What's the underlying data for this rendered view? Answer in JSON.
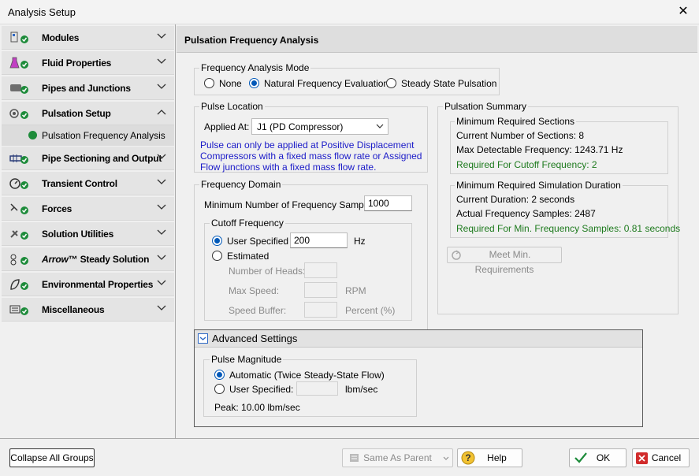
{
  "window": {
    "title": "Analysis Setup",
    "close_glyph": "✕"
  },
  "sidebar": {
    "items": [
      {
        "label": "Modules",
        "icon": "modules-icon"
      },
      {
        "label": "Fluid Properties",
        "icon": "flask-icon"
      },
      {
        "label": "Pipes and Junctions",
        "icon": "pipe-icon"
      },
      {
        "label": "Pulsation Setup",
        "icon": "pulsation-icon",
        "expanded": true
      },
      {
        "label": "Pipe Sectioning and Output",
        "icon": "sectioning-icon"
      },
      {
        "label": "Transient Control",
        "icon": "transient-icon"
      },
      {
        "label": "Forces",
        "icon": "forces-icon"
      },
      {
        "label": "Solution Utilities",
        "icon": "utilities-icon"
      },
      {
        "label": "™ Steady Solution",
        "brand": "Arrow",
        "icon": "steady-icon"
      },
      {
        "label": "Environmental Properties",
        "icon": "environment-icon"
      },
      {
        "label": "Miscellaneous",
        "icon": "misc-icon"
      }
    ],
    "subitem": {
      "label": "Pulsation Frequency Analysis"
    }
  },
  "main": {
    "title": "Pulsation Frequency Analysis",
    "mode": {
      "legend": "Frequency Analysis Mode",
      "options": [
        "None",
        "Natural Frequency Evaluation",
        "Steady State Pulsation"
      ],
      "selected": "Natural Frequency Evaluation"
    },
    "pulse_location": {
      "legend": "Pulse Location",
      "applied_label": "Applied At:",
      "applied_value": "J1 (PD Compressor)",
      "note_lines": [
        "Pulse can only be applied at Positive Displacement",
        "Compressors with a fixed mass flow rate or Assigned",
        "Flow junctions with a fixed mass flow rate."
      ]
    },
    "frequency_domain": {
      "legend": "Frequency Domain",
      "min_samples_label": "Minimum Number of Frequency Samples:",
      "min_samples_value": "1000",
      "cutoff": {
        "legend": "Cutoff Frequency",
        "user_label": "User Specified",
        "user_value": "200",
        "user_unit": "Hz",
        "estimated_label": "Estimated",
        "heads_label": "Number of Heads:",
        "speed_label": "Max Speed:",
        "speed_unit": "RPM",
        "buffer_label": "Speed Buffer:",
        "buffer_unit": "Percent (%)"
      }
    },
    "summary": {
      "legend": "Pulsation Summary",
      "sections": {
        "legend": "Minimum Required Sections",
        "line1": "Current Number of Sections: 8",
        "line2": "Max Detectable Frequency: 1243.71 Hz",
        "line3": "Required For Cutoff Frequency: 2"
      },
      "duration": {
        "legend": "Minimum Required Simulation Duration",
        "line1": "Current Duration: 2 seconds",
        "line2": "Actual Frequency Samples: 2487",
        "line3": "Required For Min. Frequency Samples: 0.81 seconds"
      },
      "meet_button": "Meet Min. Requirements"
    },
    "advanced": {
      "title": "Advanced Settings",
      "pulse_magnitude": {
        "legend": "Pulse Magnitude",
        "auto_label": "Automatic (Twice Steady-State Flow)",
        "user_label": "User Specified:",
        "user_unit": "lbm/sec",
        "peak": "Peak: 10.00 lbm/sec"
      }
    }
  },
  "footer": {
    "collapse": "Collapse All Groups",
    "same_as_parent": "Same As Parent",
    "help": "Help",
    "ok": "OK",
    "cancel": "Cancel"
  },
  "colors": {
    "accent": "#0058b8",
    "check": "#1d8b3a",
    "note": "#1a1ac8",
    "ok_text": "#1d7a1d"
  }
}
